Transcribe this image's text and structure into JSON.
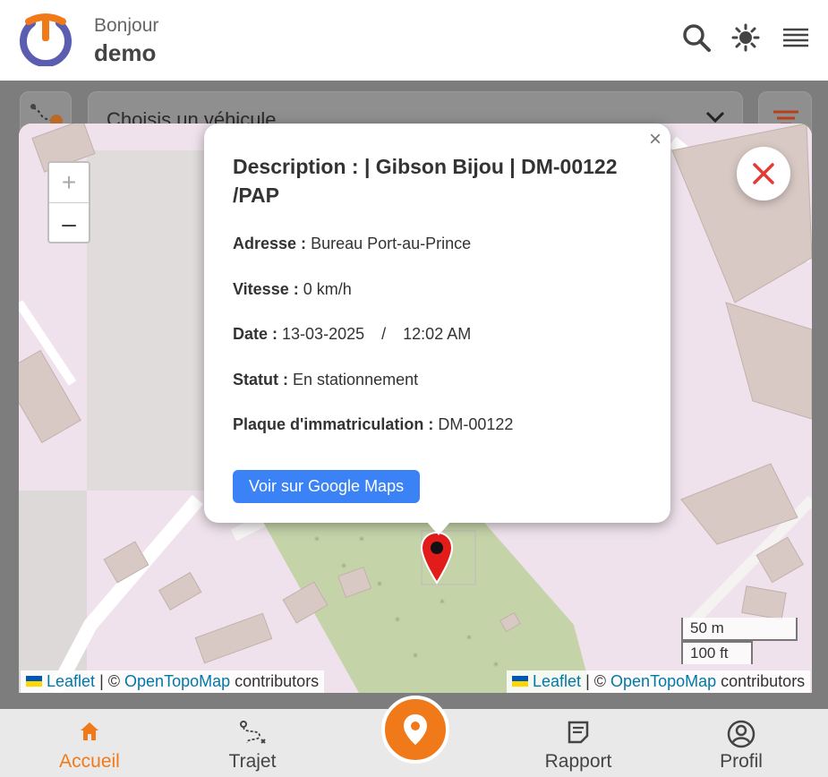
{
  "header": {
    "greeting": "Bonjour",
    "username": "demo",
    "icons": [
      "search-icon",
      "brightness-icon",
      "menu-icon"
    ]
  },
  "toolbar": {
    "vehicle_select_placeholder": "Choisis un véhicule"
  },
  "map": {
    "zoom_in": "+",
    "zoom_out": "–",
    "scale_metric": "50 m",
    "scale_imperial": "100 ft",
    "attribution": {
      "leaflet": "Leaflet",
      "sep": "| ©",
      "provider": "OpenTopoMap",
      "suffix": "contributors"
    }
  },
  "popup": {
    "close": "×",
    "title": "Description : | Gibson Bijou | DM-00122 /PAP",
    "address_label": "Adresse :",
    "address_value": "Bureau Port-au-Prince",
    "speed_label": "Vitesse :",
    "speed_value": "0 km/h",
    "date_label": "Date :",
    "date_value": "13-03-2025",
    "date_sep": "/",
    "time_value": "12:02 AM",
    "status_label": "Statut :",
    "status_value": "En stationnement",
    "plate_label": "Plaque d'immatriculation :",
    "plate_value": "DM-00122",
    "maps_button": "Voir sur Google Maps"
  },
  "nav": {
    "items": [
      {
        "label": "Accueil",
        "icon": "home-icon",
        "active": true
      },
      {
        "label": "Trajet",
        "icon": "route-icon",
        "active": false
      },
      {
        "label": "Rapport",
        "icon": "report-icon",
        "active": false
      },
      {
        "label": "Profil",
        "icon": "profile-icon",
        "active": false
      }
    ],
    "center_icon": "location-pin-icon"
  },
  "colors": {
    "accent": "#f07a1a",
    "logo_blue": "#5b5eb0",
    "button_blue": "#3b82f6",
    "close_red": "#e53935"
  }
}
